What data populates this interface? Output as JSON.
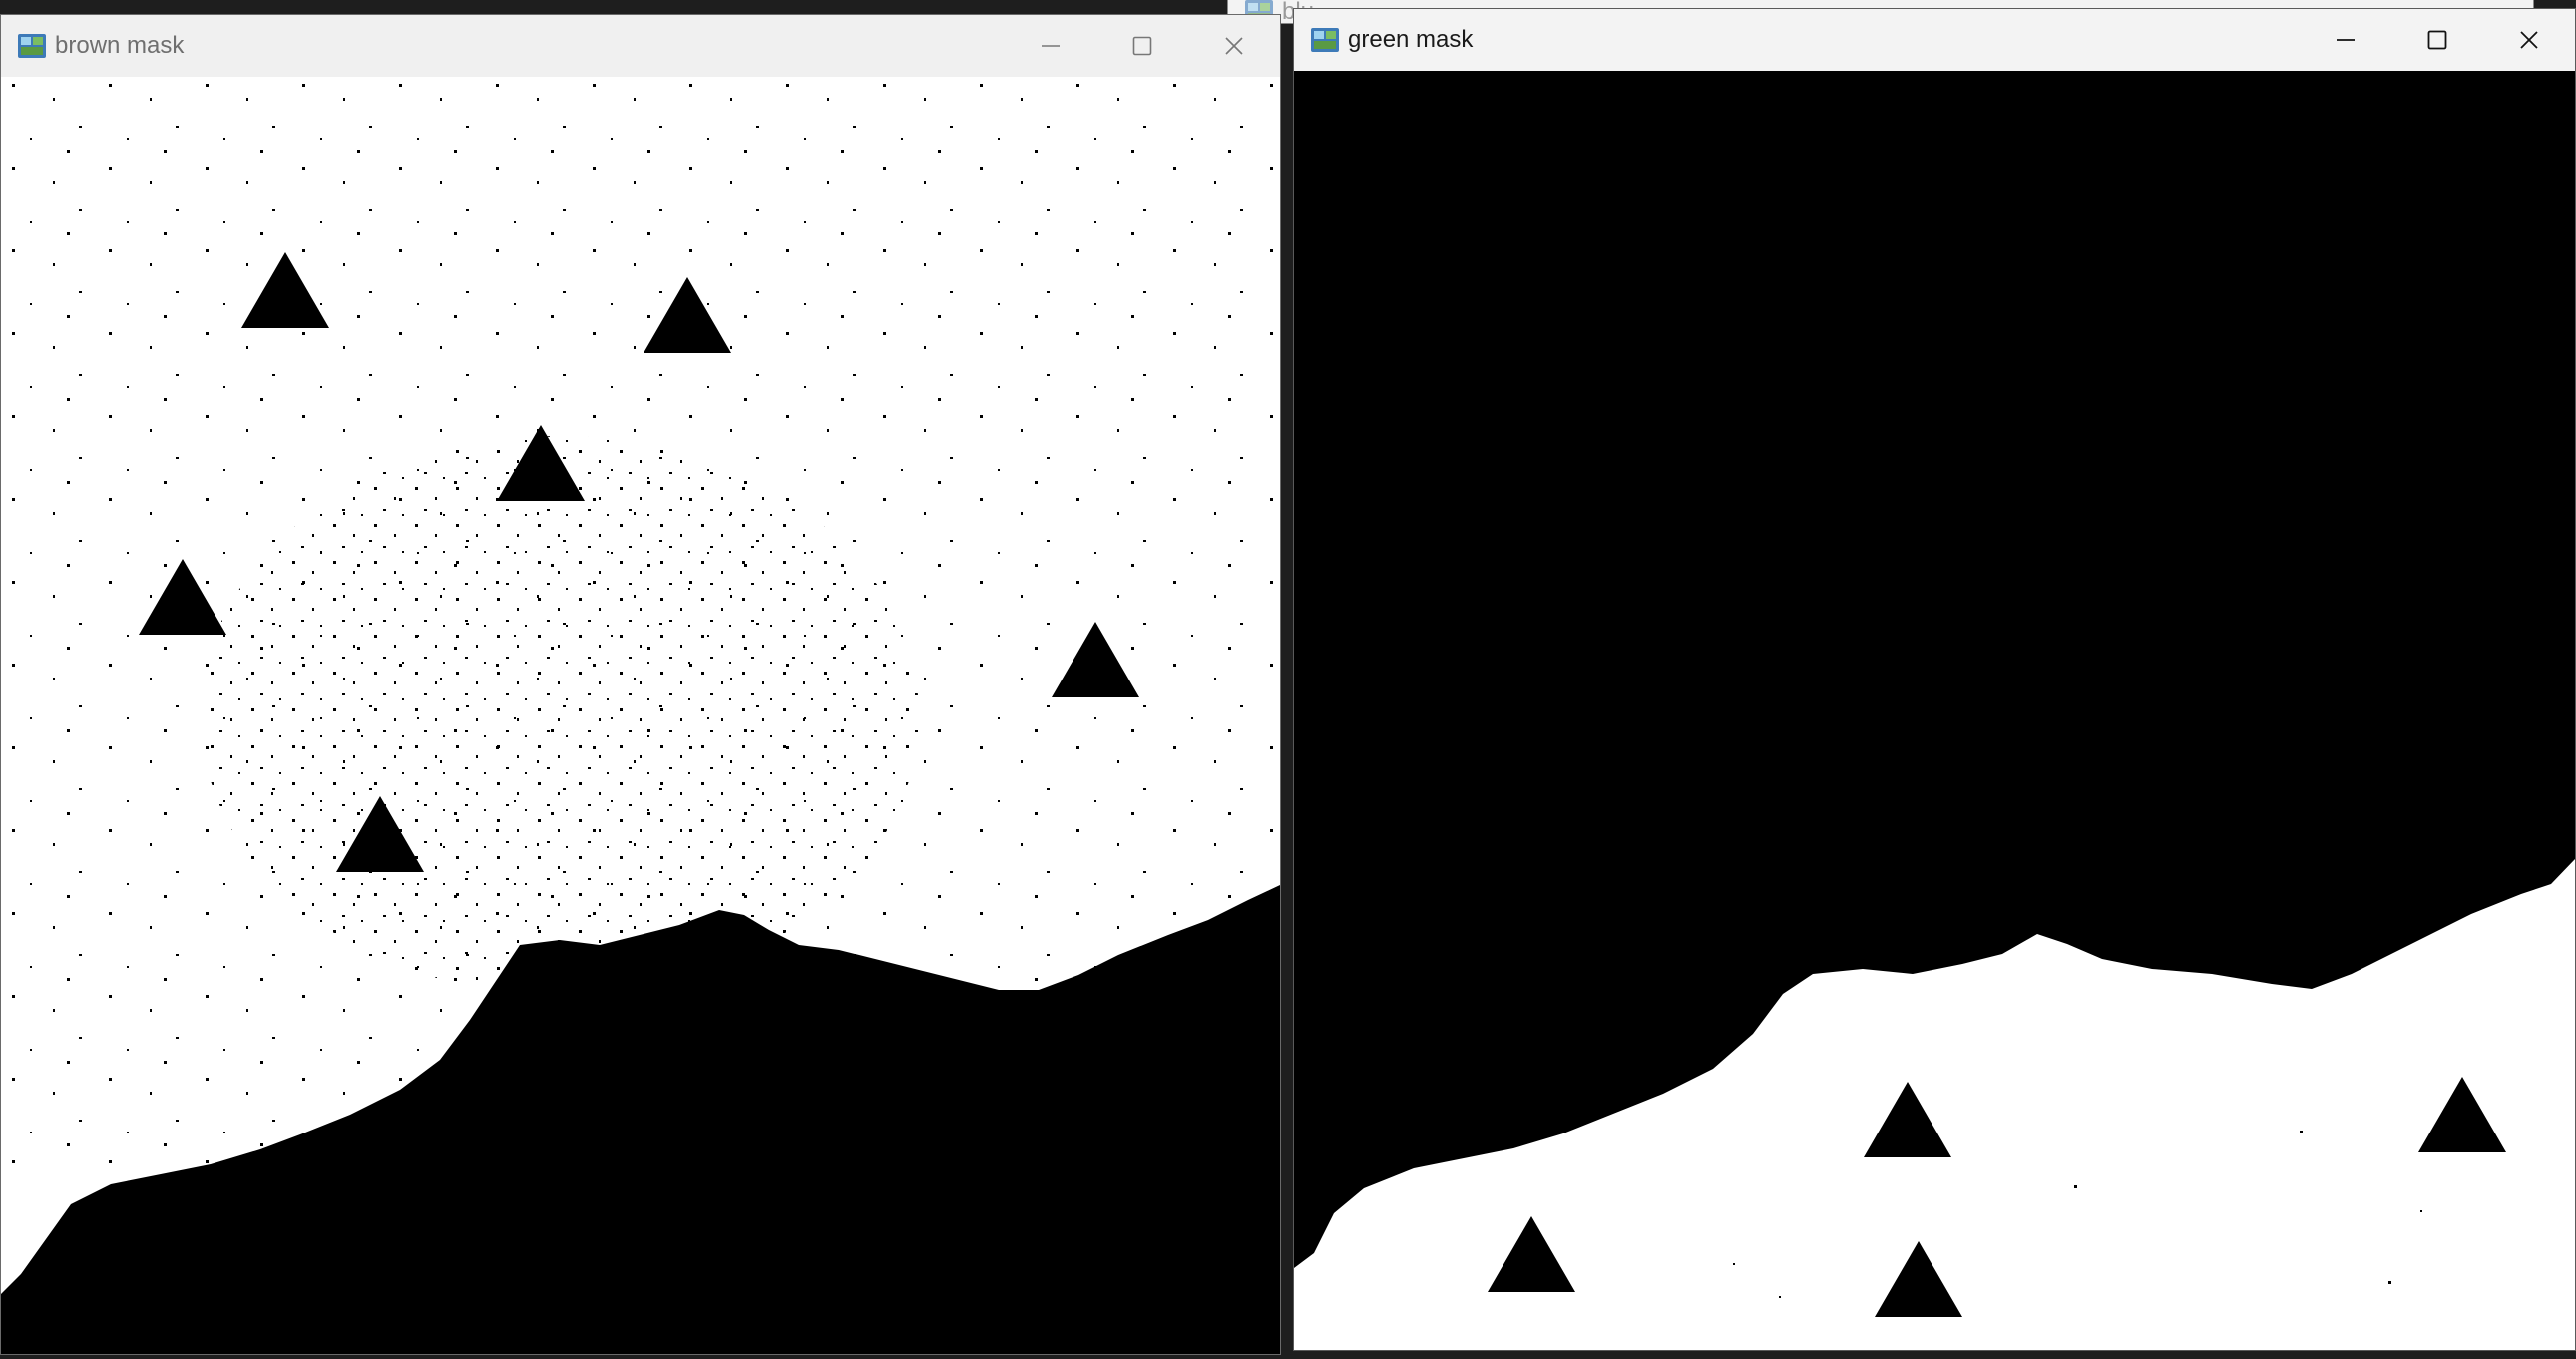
{
  "background_window": {
    "title": "blu",
    "icon": "image-viewer-icon"
  },
  "windows": [
    {
      "id": "brown",
      "title": "brown mask",
      "active": false,
      "icon": "image-viewer-icon",
      "controls": [
        "minimize-icon",
        "maximize-icon",
        "close-icon"
      ]
    },
    {
      "id": "green",
      "title": "green mask",
      "active": true,
      "icon": "image-viewer-icon",
      "controls": [
        "minimize-icon",
        "maximize-icon",
        "close-icon"
      ]
    }
  ],
  "colors": {
    "mask_foreground": "#ffffff",
    "mask_background": "#000000",
    "titlebar_inactive": "#f0f0f0",
    "titlebar_active": "#f3f3f3",
    "desktop": "#1e1e1e"
  }
}
